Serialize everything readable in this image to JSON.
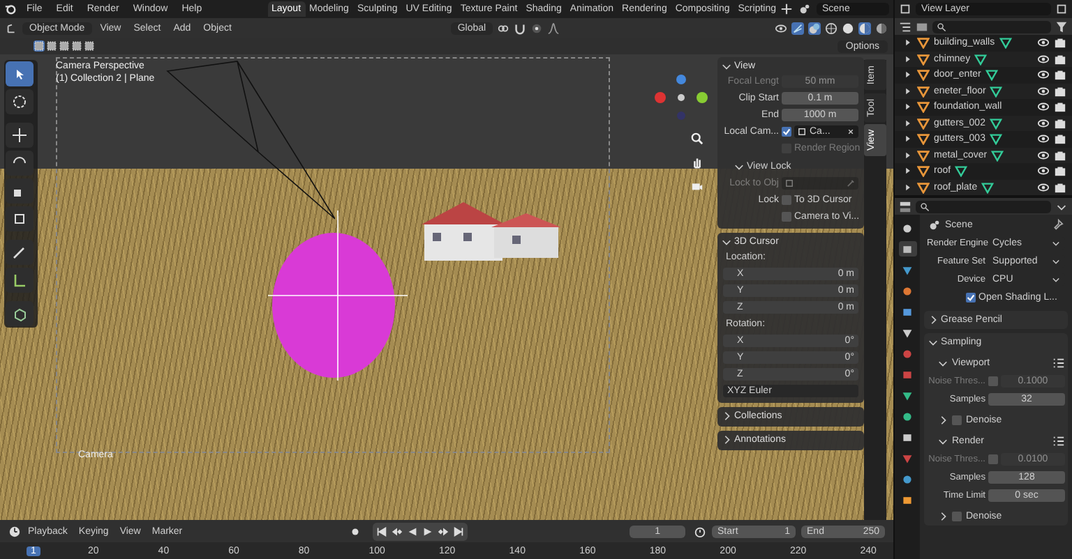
{
  "topbar": {
    "menus": [
      "File",
      "Edit",
      "Render",
      "Window",
      "Help"
    ],
    "workspaces": [
      {
        "label": "Layout",
        "selected": true
      },
      {
        "label": "Modeling",
        "selected": false
      },
      {
        "label": "Sculpting",
        "selected": false
      },
      {
        "label": "UV Editing",
        "selected": false
      },
      {
        "label": "Texture Paint",
        "selected": false
      },
      {
        "label": "Shading",
        "selected": false
      },
      {
        "label": "Animation",
        "selected": false
      },
      {
        "label": "Rendering",
        "selected": false
      },
      {
        "label": "Compositing",
        "selected": false
      },
      {
        "label": "Scripting",
        "selected": false
      }
    ],
    "scene": "Scene"
  },
  "viewport_header": {
    "mode": "Object Mode",
    "menus": [
      "View",
      "Select",
      "Add",
      "Object"
    ],
    "orientation": "Global",
    "options": "Options"
  },
  "tools": [
    {
      "selected": true
    },
    {
      "selected": false
    },
    {
      "selected": false
    },
    {
      "selected": false
    },
    {
      "selected": false
    },
    {
      "selected": false
    },
    {
      "selected": false
    },
    {
      "selected": false
    },
    {
      "selected": false
    }
  ],
  "viewport": {
    "overlay_lines": [
      "Camera Perspective",
      "(1) Collection 2 | Plane"
    ],
    "camera_label": "Camera"
  },
  "sidebar": {
    "tabs": [
      {
        "label": "Item",
        "selected": false
      },
      {
        "label": "Tool",
        "selected": false
      },
      {
        "label": "View",
        "selected": true
      }
    ],
    "panels": [
      {
        "title": "View",
        "expanded": true,
        "rows": [
          {
            "kind": "field",
            "label": "Focal Lengt",
            "value": "50 mm",
            "disabled": true
          },
          {
            "kind": "field",
            "label": "Clip Start",
            "value": "0.1 m",
            "disabled": false
          },
          {
            "kind": "field",
            "label": "End",
            "value": "1000 m",
            "disabled": false
          },
          {
            "kind": "object_field",
            "label": "Local Cam...",
            "checked": true,
            "value": "Ca...",
            "disabled": false
          },
          {
            "kind": "check",
            "text": "Render Region",
            "checked": false,
            "disabled": true
          },
          {
            "kind": "heading",
            "title": "View Lock",
            "expanded": true
          },
          {
            "kind": "object_field",
            "label": "Lock to Obj",
            "disabled": true
          },
          {
            "kind": "check",
            "label": "Lock",
            "text": "To 3D Cursor",
            "checked": false,
            "disabled": false
          },
          {
            "kind": "check",
            "text": "Camera to Vi...",
            "checked": false,
            "disabled": false
          }
        ]
      },
      {
        "title": "3D Cursor",
        "expanded": true,
        "rows": [
          {
            "kind": "caption",
            "text": "Location:"
          },
          {
            "kind": "axis",
            "label": "X",
            "value": "0 m"
          },
          {
            "kind": "axis",
            "label": "Y",
            "value": "0 m"
          },
          {
            "kind": "axis",
            "label": "Z",
            "value": "0 m"
          },
          {
            "kind": "caption",
            "text": "Rotation:"
          },
          {
            "kind": "axis",
            "label": "X",
            "value": "0°"
          },
          {
            "kind": "axis",
            "label": "Y",
            "value": "0°"
          },
          {
            "kind": "axis",
            "label": "Z",
            "value": "0°"
          },
          {
            "kind": "dropdown",
            "value": "XYZ Euler"
          }
        ]
      },
      {
        "title": "Collections",
        "expanded": false
      },
      {
        "title": "Annotations",
        "expanded": false
      }
    ]
  },
  "outliner": {
    "header": "View Layer",
    "items": [
      {
        "name": "building_walls",
        "has_data": true
      },
      {
        "name": "chimney",
        "has_data": true
      },
      {
        "name": "door_enter",
        "has_data": true
      },
      {
        "name": "eneter_floor",
        "has_data": true
      },
      {
        "name": "foundation_wall",
        "has_data": false
      },
      {
        "name": "gutters_002",
        "has_data": true
      },
      {
        "name": "gutters_003",
        "has_data": true
      },
      {
        "name": "metal_cover",
        "has_data": true
      },
      {
        "name": "roof",
        "has_data": true
      },
      {
        "name": "roof_plate",
        "has_data": true
      }
    ]
  },
  "properties": {
    "tabs": [
      {
        "selected": false
      },
      {
        "selected": true
      },
      {
        "selected": false
      },
      {
        "selected": false
      },
      {
        "selected": false
      },
      {
        "selected": false
      },
      {
        "selected": false
      },
      {
        "selected": false
      },
      {
        "selected": false
      },
      {
        "selected": false
      },
      {
        "selected": false
      },
      {
        "selected": false
      },
      {
        "selected": false
      },
      {
        "selected": false
      }
    ],
    "context": "Scene",
    "panels": [
      {
        "rows": [
          {
            "kind": "dropdown",
            "label": "Render Engine",
            "value": "Cycles"
          },
          {
            "kind": "dropdown",
            "label": "Feature Set",
            "value": "Supported"
          },
          {
            "kind": "dropdown",
            "label": "Device",
            "value": "CPU"
          },
          {
            "kind": "check",
            "text": "Open Shading L...",
            "checked": true,
            "disabled": false
          }
        ]
      },
      {
        "title": "Grease Pencil",
        "expanded": false
      },
      {
        "title": "Sampling",
        "expanded": true,
        "rows": [
          {
            "kind": "heading",
            "title": "Viewport",
            "expanded": true,
            "presets": true
          },
          {
            "kind": "field_check",
            "label": "Noise Thres...",
            "checked": false,
            "value": "0.1000",
            "disabled": true
          },
          {
            "kind": "field",
            "label": "Samples",
            "value": "32",
            "disabled": false
          },
          {
            "kind": "heading",
            "title": "Denoise",
            "expanded": false,
            "checked": false
          },
          {
            "kind": "heading",
            "title": "Render",
            "expanded": true,
            "presets": true
          },
          {
            "kind": "field_check",
            "label": "Noise Thres...",
            "checked": false,
            "value": "0.0100",
            "disabled": true
          },
          {
            "kind": "field",
            "label": "Samples",
            "value": "128",
            "disabled": false
          },
          {
            "kind": "field",
            "label": "Time Limit",
            "value": "0 sec",
            "disabled": false
          },
          {
            "kind": "heading",
            "title": "Denoise",
            "expanded": false,
            "checked": false
          }
        ]
      }
    ]
  },
  "timeline": {
    "menus": [
      "Playback",
      "Keying",
      "View",
      "Marker"
    ],
    "current_frame": "1",
    "start_label": "Start",
    "start": "1",
    "end_label": "End",
    "end": "250",
    "ruler": [
      {
        "label": "1",
        "selected": true
      },
      {
        "label": "20",
        "selected": false
      },
      {
        "label": "40",
        "selected": false
      },
      {
        "label": "60",
        "selected": false
      },
      {
        "label": "80",
        "selected": false
      },
      {
        "label": "100",
        "selected": false
      },
      {
        "label": "120",
        "selected": false
      },
      {
        "label": "140",
        "selected": false
      },
      {
        "label": "160",
        "selected": false
      },
      {
        "label": "180",
        "selected": false
      },
      {
        "label": "200",
        "selected": false
      },
      {
        "label": "220",
        "selected": false
      },
      {
        "label": "240",
        "selected": false
      }
    ]
  }
}
